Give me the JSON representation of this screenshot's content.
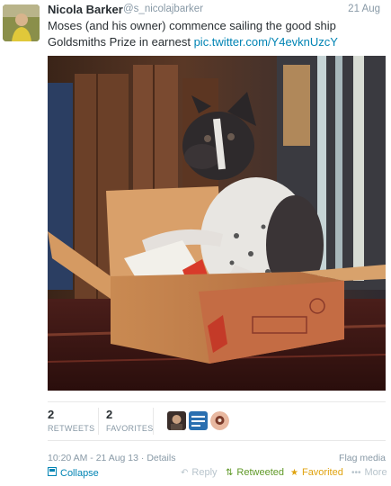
{
  "tweet": {
    "name": "Nicola Barker",
    "handle": "@s_nicolajbarker",
    "date": "21 Aug",
    "text": "Moses (and his owner) commence sailing the good ship Goldsmiths Prize in earnest",
    "link": "pic.twitter.com/Y4evknUzcY"
  },
  "stats": {
    "retweets_count": "2",
    "retweets_label": "RETWEETS",
    "favorites_count": "2",
    "favorites_label": "FAVORITES"
  },
  "meta": {
    "timestamp": "10:20 AM - 21 Aug 13",
    "separator": "·",
    "details": "Details",
    "flag": "Flag media"
  },
  "actions": {
    "collapse": "Collapse",
    "reply": "Reply",
    "retweeted": "Retweeted",
    "favorited": "Favorited",
    "more": "More"
  },
  "colors": {
    "link": "#0084b4",
    "retweeted": "#609928",
    "favorited": "#e0a30f",
    "muted": "#8899a6"
  },
  "icons": {
    "collapse": "collapse-icon",
    "reply": "reply-icon",
    "retweet": "retweet-icon",
    "favorite": "star-icon",
    "more": "more-icon"
  }
}
